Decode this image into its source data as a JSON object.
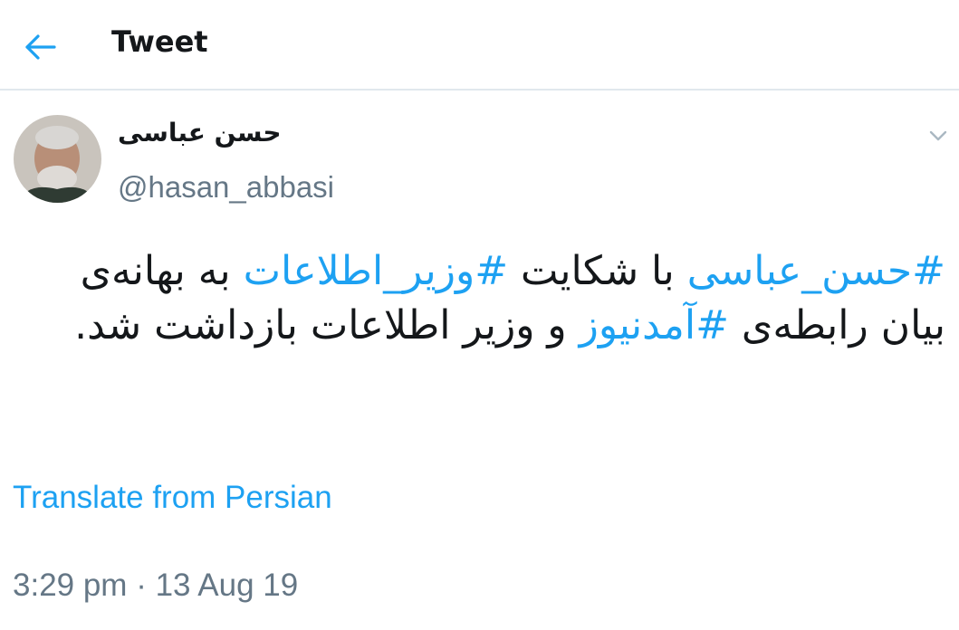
{
  "header": {
    "title": "Tweet",
    "back_icon": "arrow-left-icon",
    "accent": "#1da1f2"
  },
  "author": {
    "name": "حسن عباسی",
    "handle": "@hasan_abbasi"
  },
  "tweet": {
    "segments": [
      {
        "text": "#حسن_عباسی",
        "hashtag": true
      },
      {
        "text": " با شکایت ",
        "hashtag": false
      },
      {
        "text": "#وزیر_اطلاعات",
        "hashtag": true
      },
      {
        "text": " به بهانه‌ی بیان رابطه‌ی ",
        "hashtag": false
      },
      {
        "text": "#آمدنیوز",
        "hashtag": true
      },
      {
        "text": " و وزیر اطلاعات بازداشت شد.",
        "hashtag": false
      }
    ],
    "translate_label": "Translate from Persian",
    "timestamp": "3:29 pm · 13 Aug 19"
  },
  "colors": {
    "link": "#1da1f2",
    "secondary": "#657786",
    "divider": "#e1e8ed"
  }
}
